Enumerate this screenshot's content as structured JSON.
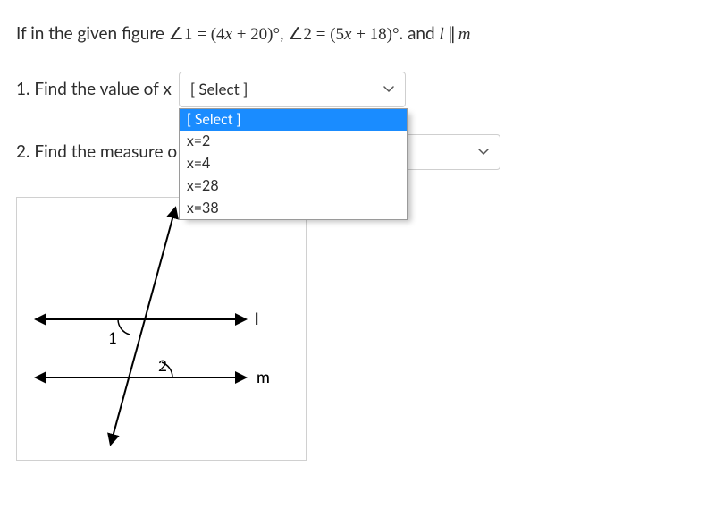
{
  "prompt": {
    "prefix": "If in the given figure ",
    "angle1_lhs": "∠1",
    "eq": " = ",
    "angle1_rhs_open": "(4",
    "xvar": "x",
    "angle1_rhs_mid": " + 20)",
    "deg": "°",
    "comma": ", ",
    "angle2_lhs": "∠2",
    "angle2_rhs_open": "(5",
    "angle2_rhs_mid": " + 18)",
    "suffix_and": ". and ",
    "lvar": "l",
    "parallel": " ∥ ",
    "mvar": "m"
  },
  "q1": {
    "label": "1. Find the value of x",
    "selected": "[ Select ]",
    "options": [
      "[ Select ]",
      "x=2",
      "x=4",
      "x=28",
      "x=38"
    ]
  },
  "q2": {
    "label": "2. Find the measure o",
    "selected": ""
  },
  "figure": {
    "label_l": "l",
    "label_m": "m",
    "label_1": "1",
    "label_2": "2"
  }
}
